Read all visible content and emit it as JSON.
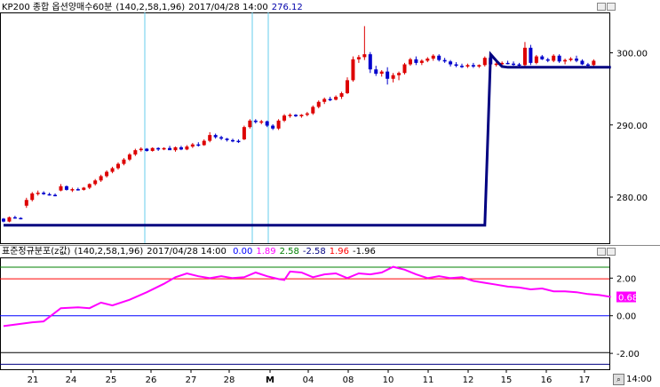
{
  "upper_header": {
    "title": "KP200 종합 옵션양매수60분",
    "params": "(140,2,58,1,96)",
    "timestamp": "2017/04/28 14:00",
    "value": "276.12",
    "value_color": "#0000aa"
  },
  "lower_header": {
    "title": "표준정규분포(z값)",
    "params": "(140,2,58,1,96)",
    "timestamp": "2017/04/28 14:00",
    "values": [
      {
        "text": "0.00",
        "color": "#0000ff"
      },
      {
        "text": "1.89",
        "color": "#ff00ff"
      },
      {
        "text": "2.58",
        "color": "#008000"
      },
      {
        "text": "-2.58",
        "color": "#000080"
      },
      {
        "text": "1.96",
        "color": "#ff0000"
      },
      {
        "text": "-1.96",
        "color": "#000000"
      }
    ]
  },
  "colors": {
    "up": "#dd0000",
    "down": "#0000cc",
    "overlay_line": "#000080",
    "z_line": "#ff00ff",
    "vline": "#66ccee",
    "level_2_58": "#008000",
    "level_1_96": "#ff0000",
    "level_0": "#0000ff",
    "level_neg_1_96": "#000000",
    "level_neg_2_58": "#000080"
  },
  "axis_labels": {
    "x_label": "14:00",
    "current_z_label": "0.68"
  },
  "chart_data": [
    {
      "type": "candlestick",
      "title": "KP200 종합 옵션양매수60분",
      "x_labels": [
        "21",
        "24",
        "25",
        "26",
        "27",
        "28",
        "M",
        "04",
        "08",
        "10",
        "11",
        "12",
        "15",
        "16",
        "17"
      ],
      "y_ticks": [
        "300.00",
        "290.00",
        "280.00"
      ],
      "ylim": [
        273.6,
        305.6
      ],
      "markers_at_x": [
        "26",
        "28",
        "M"
      ],
      "series": [
        {
          "name": "candles",
          "ohlc": [
            [
              277.0,
              277.1,
              276.5,
              276.6
            ],
            [
              276.6,
              277.3,
              276.5,
              277.2
            ],
            [
              277.2,
              277.4,
              277.0,
              277.1
            ],
            [
              277.1,
              277.2,
              276.9,
              277.0
            ],
            [
              278.8,
              279.9,
              278.5,
              279.6
            ],
            [
              279.6,
              280.7,
              279.4,
              280.5
            ],
            [
              280.5,
              280.9,
              280.2,
              280.6
            ],
            [
              280.6,
              280.8,
              280.3,
              280.4
            ],
            [
              280.4,
              280.6,
              280.2,
              280.3
            ],
            [
              280.3,
              280.5,
              280.1,
              280.2
            ],
            [
              280.9,
              281.8,
              280.8,
              281.5
            ],
            [
              281.5,
              281.6,
              280.9,
              281.0
            ],
            [
              281.0,
              281.3,
              280.7,
              281.1
            ],
            [
              281.1,
              281.3,
              280.9,
              281.0
            ],
            [
              281.0,
              281.4,
              280.9,
              281.3
            ],
            [
              281.3,
              281.9,
              281.1,
              281.8
            ],
            [
              281.8,
              282.5,
              281.6,
              282.3
            ],
            [
              282.3,
              283.1,
              282.1,
              282.9
            ],
            [
              282.9,
              283.7,
              282.7,
              283.5
            ],
            [
              283.5,
              284.2,
              283.3,
              284.0
            ],
            [
              284.0,
              284.8,
              283.8,
              284.6
            ],
            [
              284.6,
              285.4,
              284.4,
              285.2
            ],
            [
              285.2,
              286.1,
              285.0,
              285.9
            ],
            [
              285.9,
              286.7,
              285.7,
              286.5
            ],
            [
              286.5,
              286.9,
              286.3,
              286.7
            ],
            [
              286.7,
              286.8,
              286.3,
              286.4
            ],
            [
              286.4,
              286.9,
              286.3,
              286.8
            ],
            [
              286.8,
              286.9,
              286.4,
              286.6
            ],
            [
              286.6,
              286.9,
              286.5,
              286.8
            ],
            [
              286.8,
              287.1,
              286.6,
              286.5
            ],
            [
              286.5,
              287.0,
              286.3,
              286.9
            ],
            [
              286.9,
              287.1,
              286.5,
              286.6
            ],
            [
              286.6,
              287.2,
              286.5,
              287.0
            ],
            [
              287.0,
              287.5,
              286.8,
              287.3
            ],
            [
              287.3,
              287.6,
              287.0,
              287.2
            ],
            [
              287.2,
              288.0,
              287.1,
              287.8
            ],
            [
              287.8,
              289.0,
              287.6,
              288.6
            ],
            [
              288.6,
              288.8,
              288.1,
              288.3
            ],
            [
              288.3,
              288.5,
              287.9,
              288.1
            ],
            [
              288.1,
              288.2,
              287.7,
              287.9
            ],
            [
              287.9,
              288.1,
              287.6,
              287.8
            ],
            [
              287.8,
              288.0,
              287.5,
              287.7
            ],
            [
              288.0,
              289.9,
              287.9,
              289.7
            ],
            [
              289.7,
              290.8,
              289.5,
              290.6
            ],
            [
              290.6,
              290.8,
              290.2,
              290.4
            ],
            [
              290.4,
              290.7,
              290.1,
              290.5
            ],
            [
              290.5,
              290.6,
              289.7,
              289.9
            ],
            [
              289.9,
              290.1,
              289.3,
              289.5
            ],
            [
              289.5,
              290.8,
              289.3,
              290.6
            ],
            [
              290.6,
              291.5,
              290.4,
              291.3
            ],
            [
              291.3,
              291.6,
              291.0,
              291.4
            ],
            [
              291.4,
              291.5,
              291.1,
              291.2
            ],
            [
              291.2,
              291.5,
              291.0,
              291.4
            ],
            [
              291.4,
              291.8,
              291.2,
              291.6
            ],
            [
              291.6,
              292.7,
              291.4,
              292.5
            ],
            [
              292.5,
              293.4,
              292.3,
              293.2
            ],
            [
              293.2,
              293.8,
              292.9,
              293.6
            ],
            [
              293.6,
              293.9,
              293.3,
              293.5
            ],
            [
              293.5,
              294.1,
              293.4,
              293.9
            ],
            [
              293.9,
              294.6,
              293.6,
              294.4
            ],
            [
              294.4,
              296.6,
              294.3,
              296.2
            ],
            [
              296.2,
              299.5,
              296.0,
              299.1
            ],
            [
              299.1,
              299.7,
              298.6,
              299.4
            ],
            [
              299.4,
              303.7,
              299.0,
              299.8
            ],
            [
              299.8,
              300.1,
              297.2,
              297.7
            ],
            [
              297.7,
              298.2,
              296.8,
              297.1
            ],
            [
              297.1,
              297.6,
              296.7,
              297.4
            ],
            [
              297.4,
              298.0,
              295.6,
              296.4
            ],
            [
              296.4,
              297.2,
              295.9,
              296.9
            ],
            [
              296.9,
              297.4,
              296.2,
              297.2
            ],
            [
              297.2,
              298.6,
              297.0,
              298.4
            ],
            [
              298.4,
              299.3,
              298.2,
              299.1
            ],
            [
              299.1,
              299.5,
              298.3,
              298.6
            ],
            [
              298.6,
              299.1,
              298.3,
              298.9
            ],
            [
              298.9,
              299.4,
              298.7,
              299.2
            ],
            [
              299.2,
              299.8,
              298.9,
              299.6
            ],
            [
              299.6,
              299.8,
              298.8,
              299.0
            ],
            [
              299.0,
              299.3,
              298.6,
              298.8
            ],
            [
              298.8,
              299.0,
              298.1,
              298.4
            ],
            [
              298.4,
              298.7,
              298.0,
              298.2
            ],
            [
              298.2,
              298.5,
              297.9,
              298.1
            ],
            [
              298.1,
              298.5,
              297.9,
              298.3
            ],
            [
              298.3,
              298.6,
              297.9,
              298.1
            ],
            [
              298.1,
              298.4,
              297.9,
              298.3
            ],
            [
              298.3,
              299.5,
              298.1,
              299.3
            ],
            [
              299.3,
              299.5,
              298.2,
              298.4
            ],
            [
              298.4,
              298.7,
              298.1,
              298.5
            ],
            [
              298.5,
              298.8,
              298.2,
              298.6
            ],
            [
              298.6,
              298.9,
              298.4,
              298.5
            ],
            [
              298.5,
              298.8,
              298.2,
              298.4
            ],
            [
              298.4,
              298.6,
              298.1,
              298.3
            ],
            [
              298.3,
              301.5,
              298.1,
              300.7
            ],
            [
              300.7,
              301.1,
              298.3,
              298.6
            ],
            [
              298.6,
              299.7,
              298.4,
              299.5
            ],
            [
              299.5,
              299.7,
              299.0,
              299.1
            ],
            [
              299.1,
              299.3,
              298.7,
              298.9
            ],
            [
              298.9,
              299.8,
              298.7,
              299.6
            ],
            [
              299.6,
              299.8,
              298.6,
              298.8
            ],
            [
              298.8,
              299.2,
              298.4,
              299.0
            ],
            [
              299.0,
              299.4,
              298.8,
              299.2
            ],
            [
              299.2,
              299.6,
              298.7,
              298.9
            ],
            [
              298.9,
              299.1,
              298.3,
              298.4
            ],
            [
              298.4,
              298.6,
              298.1,
              298.3
            ],
            [
              298.3,
              299.1,
              298.1,
              298.9
            ]
          ]
        },
        {
          "name": "overlay",
          "points": [
            [
              0,
              276.1
            ],
            [
              84,
              276.1
            ],
            [
              85,
              299.8
            ],
            [
              86,
              298.9
            ],
            [
              87,
              298.1
            ],
            [
              88,
              298.0
            ],
            [
              106,
              298.0
            ]
          ]
        }
      ]
    },
    {
      "type": "line",
      "title": "표준정규분포(z값)",
      "y_ticks": [
        "2.00",
        "0.00",
        "-2.00"
      ],
      "ylim": [
        -2.75,
        3.1
      ],
      "levels": [
        {
          "value": 2.58,
          "name": "2.58"
        },
        {
          "value": 1.96,
          "name": "1.96"
        },
        {
          "value": 0,
          "name": "0.00"
        },
        {
          "value": -1.96,
          "name": "-1.96"
        },
        {
          "value": -2.58,
          "name": "-2.58"
        }
      ],
      "series": [
        {
          "name": "z",
          "points": [
            [
              0,
              -0.55
            ],
            [
              5,
              -0.35
            ],
            [
              7,
              -0.3
            ],
            [
              10,
              0.4
            ],
            [
              13,
              0.45
            ],
            [
              15,
              0.4
            ],
            [
              17,
              0.7
            ],
            [
              19,
              0.55
            ],
            [
              22,
              0.85
            ],
            [
              25,
              1.25
            ],
            [
              28,
              1.7
            ],
            [
              30,
              2.05
            ],
            [
              32,
              2.25
            ],
            [
              34,
              2.1
            ],
            [
              36,
              2.0
            ],
            [
              38,
              2.1
            ],
            [
              40,
              2.0
            ],
            [
              42,
              2.05
            ],
            [
              44,
              2.3
            ],
            [
              46,
              2.1
            ],
            [
              48,
              1.95
            ],
            [
              49,
              1.9
            ],
            [
              50,
              2.35
            ],
            [
              52,
              2.3
            ],
            [
              54,
              2.05
            ],
            [
              56,
              2.2
            ],
            [
              58,
              2.25
            ],
            [
              60,
              2.0
            ],
            [
              62,
              2.25
            ],
            [
              64,
              2.2
            ],
            [
              66,
              2.3
            ],
            [
              68,
              2.6
            ],
            [
              70,
              2.45
            ],
            [
              72,
              2.2
            ],
            [
              74,
              2.0
            ],
            [
              76,
              2.1
            ],
            [
              78,
              2.0
            ],
            [
              80,
              2.05
            ],
            [
              82,
              1.85
            ],
            [
              84,
              1.75
            ],
            [
              86,
              1.65
            ],
            [
              88,
              1.55
            ],
            [
              90,
              1.5
            ],
            [
              92,
              1.4
            ],
            [
              94,
              1.45
            ],
            [
              96,
              1.3
            ],
            [
              98,
              1.3
            ],
            [
              100,
              1.25
            ],
            [
              102,
              1.15
            ],
            [
              104,
              1.1
            ],
            [
              106,
              1.0
            ]
          ]
        }
      ]
    }
  ]
}
